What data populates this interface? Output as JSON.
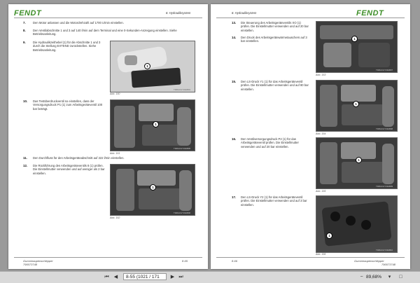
{
  "left_page": {
    "logo": "FENDT",
    "section": "8. Hydrauliksystem",
    "steps": [
      {
        "num": "7.",
        "text": "Den Motor anlassen und die Motordrehzahl auf 1700 U/min einstellen."
      },
      {
        "num": "8.",
        "text": "Den Ventilabschnitte 1 und 3 auf 140 l/min auf dem Terminal und eine 0-Sekunden-Anzeigung einstellen. Siehe Betriebsanleitung."
      },
      {
        "num": "9.",
        "text": "Die Hydraulikzeithebel (1) für die Abschnitte 1 und 3 durch die Stellung EXTEND zurückstellen. Siehe Betriebsanleitung."
      },
      {
        "num": "10.",
        "text": "Das Testüberdruckventil so einstellen, dass der Versorgungsdruck P1 (1) zum Arbeitsgeräteventil 100 bar beträgt."
      },
      {
        "num": "11.",
        "text": "Den Durchfluss für den Arbeitsgeräteabschnitt auf 222 l/min einstellen."
      },
      {
        "num": "12.",
        "text": "Die Rückführung des Arbeitsgeräteventils 8 (1) prüfen. Die Einstellmutter verwenden und auf weniger als 2 bar einstellen."
      }
    ],
    "captions": [
      "Abb. 150",
      "Abb. 151",
      "Abb. 152"
    ],
    "codes": [
      "TR4M-FHY03AB01",
      "TR4M-FHY03AB05",
      "TR4M-FHY03AB06"
    ],
    "footer_left": "Gummiraupenschlepper",
    "footer_left2": "790073748",
    "footer_right": "8-65"
  },
  "right_page": {
    "logo": "FENDT",
    "section": "8. Hydrauliksystem",
    "steps": [
      {
        "num": "13.",
        "text": "Die Steuerung des Arbeitsgeräteventils XO (1) prüfen. Die Einstellmutter verwenden und auf 20 bar einstellen."
      },
      {
        "num": "14.",
        "text": "Den Druck des Arbeitsgerätewärmetauschers auf 3 bar einstellen."
      },
      {
        "num": "15.",
        "text": "Den LS-Druck Y1 (1) für das Arbeitsgeräteventil prüfen. Die Einstellmutter verwenden und auf 80 bar einstellen."
      },
      {
        "num": "16.",
        "text": "Den Ventilversorgungsdruck P2 (1) für das Arbeitsgeräteventil prüfen. Die Einstellmutter verwenden und auf 20 bar einstellen."
      },
      {
        "num": "17.",
        "text": "Den LS-Druck Y2 (1) für das Arbeitsgeräteventil prüfen. Die Einstellmutter verwenden und auf 3 bar einstellen."
      }
    ],
    "captions": [
      "Abb. 153",
      "Abb. 154",
      "Abb. 155",
      "Abb. 156"
    ],
    "codes": [
      "TR4M-FHY03AB07",
      "TR4M-FHY03AB08",
      "TR4M-FHY03AB09",
      "TR4M-FHY03AB10"
    ],
    "footer_left": "8-66",
    "footer_right": "Gummiraupenschlepper",
    "footer_right2": "790073748"
  },
  "callout_label": "1",
  "statusbar": {
    "page_field": "8-55 (1021 / 171",
    "zoom": "89,68%",
    "icons": [
      "first-page-icon",
      "prev-page-icon",
      "next-page-icon",
      "last-page-icon"
    ]
  },
  "colors": {
    "brand_green": "#3f8f2a"
  }
}
